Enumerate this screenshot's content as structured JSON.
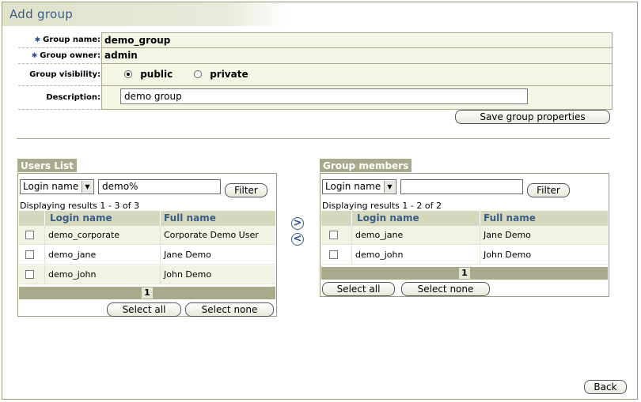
{
  "title": "Add group",
  "form": {
    "group_name_label": "Group name:",
    "group_name_value": "demo_group",
    "group_owner_label": "Group owner:",
    "group_owner_value": "admin",
    "visibility_label": "Group visibility:",
    "visibility_public": "public",
    "visibility_private": "private",
    "description_label": "Description:",
    "description_value": "demo group",
    "save_label": "Save group properties"
  },
  "users_list": {
    "tab_label": "Users List",
    "filter_field": "Login name",
    "filter_value": "demo%",
    "filter_button": "Filter",
    "results_text": "Displaying results 1 - 3 of 3",
    "col_login": "Login name",
    "col_full": "Full name",
    "rows": [
      {
        "login": "demo_corporate",
        "full": "Corporate Demo User"
      },
      {
        "login": "demo_jane",
        "full": "Jane Demo"
      },
      {
        "login": "demo_john",
        "full": "John Demo"
      }
    ],
    "page": "1",
    "select_all": "Select all",
    "select_none": "Select none"
  },
  "group_members": {
    "tab_label": "Group members",
    "filter_field": "Login name",
    "filter_value": "",
    "filter_button": "Filter",
    "results_text": "Displaying results 1 - 2 of 2",
    "col_login": "Login name",
    "col_full": "Full name",
    "rows": [
      {
        "login": "demo_jane",
        "full": "Jane Demo"
      },
      {
        "login": "demo_john",
        "full": "John Demo"
      }
    ],
    "page": "1",
    "select_all": "Select all",
    "select_none": "Select none"
  },
  "move": {
    "add_glyph": ">",
    "remove_glyph": "<"
  },
  "back_label": "Back",
  "colors": {
    "accent": "#3a5d86",
    "tab_bg": "#a9a98b",
    "header_bg": "#d6d8bd"
  }
}
